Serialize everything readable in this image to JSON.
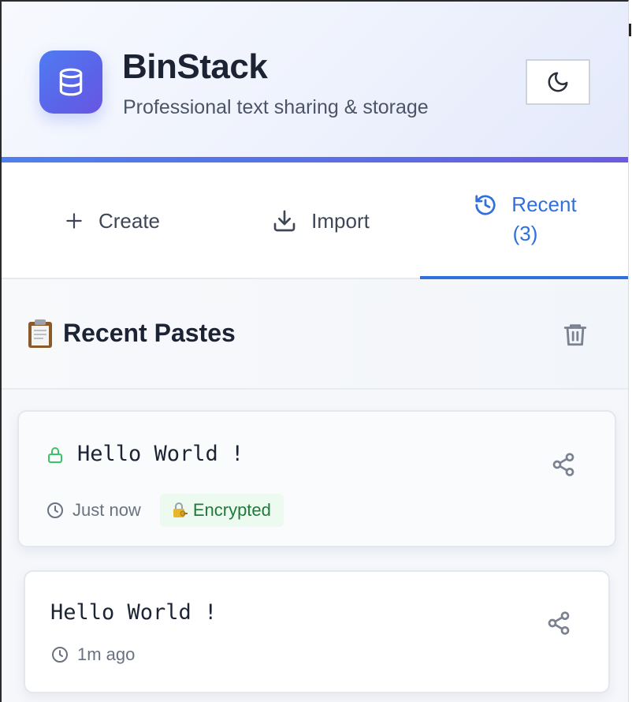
{
  "header": {
    "title": "BinStack",
    "subtitle": "Professional text sharing & storage",
    "logo_icon": "database-icon",
    "theme_toggle_icon": "moon-icon"
  },
  "tabs": [
    {
      "label": "Create",
      "icon": "plus-icon",
      "active": false
    },
    {
      "label": "Import",
      "icon": "download-icon",
      "active": false
    },
    {
      "label": "Recent",
      "count": "(3)",
      "icon": "history-icon",
      "active": true
    }
  ],
  "recent": {
    "title": "Recent Pastes",
    "title_icon": "clipboard-icon",
    "clear_icon": "trash-icon",
    "items": [
      {
        "title": "Hello World !",
        "time": "Just now",
        "badge": "Encrypted",
        "locked": true
      },
      {
        "title": "Hello World !",
        "time": "1m ago",
        "locked": false
      }
    ]
  },
  "colors": {
    "accent": "#2f6fde",
    "brand_gradient_start": "#4f7cf2",
    "brand_gradient_end": "#6a55e3",
    "encrypted_badge_bg": "#edfaf0",
    "encrypted_badge_text": "#1f7a3a",
    "lock_green": "#3cc36a"
  }
}
